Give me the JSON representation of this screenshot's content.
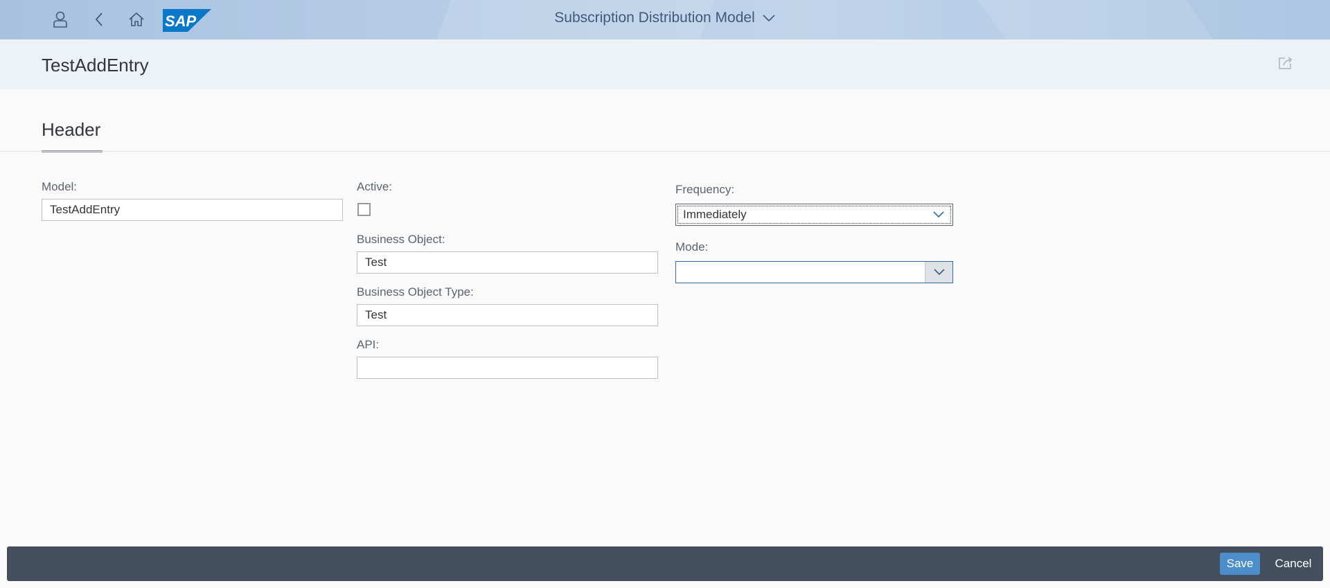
{
  "shell": {
    "title": "Subscription Distribution Model",
    "logo_text": "SAP",
    "icons": [
      "user-icon",
      "back-icon",
      "home-icon",
      "title-dropdown-icon"
    ]
  },
  "object": {
    "title": "TestAddEntry",
    "share_icon": "share-icon"
  },
  "section": {
    "tab_label": "Header"
  },
  "form": {
    "model_label": "Model:",
    "model_value": "TestAddEntry",
    "active_label": "Active:",
    "active_checked": false,
    "business_object_label": "Business Object:",
    "business_object_value": "Test",
    "business_object_type_label": "Business Object Type:",
    "business_object_type_value": "Test",
    "api_label": "API:",
    "api_value": "",
    "frequency_label": "Frequency:",
    "frequency_value": "Immediately",
    "mode_label": "Mode:",
    "mode_value": ""
  },
  "footer": {
    "save_label": "Save",
    "cancel_label": "Cancel"
  },
  "colors": {
    "shell_bg": "#b6cde6",
    "footer_bg": "#434f5c",
    "save_button": "#4b8ec9",
    "select_focus": "#2f6aa3"
  }
}
